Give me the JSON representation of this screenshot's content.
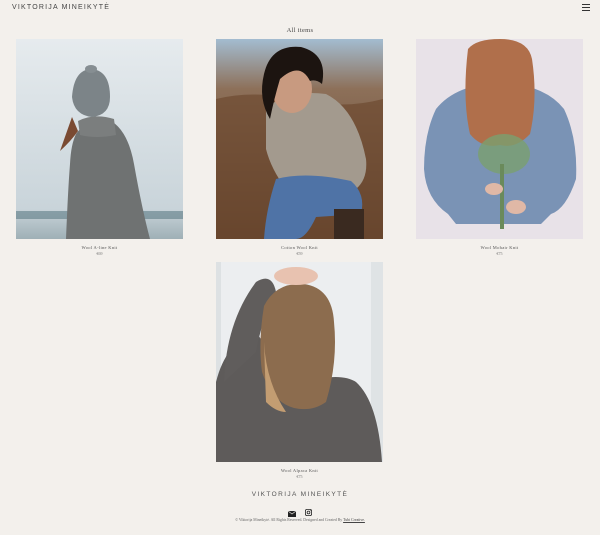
{
  "header": {
    "logo": "VIKTORIJA MINEIKYTĖ"
  },
  "main": {
    "title": "All items"
  },
  "products": [
    {
      "name": "Wool A-line Knit",
      "price": "€69"
    },
    {
      "name": "Cotton Wool Knit",
      "price": "€59"
    },
    {
      "name": "Wool Mohair Knit",
      "price": "€75"
    },
    {
      "name": "Wool Alpaca Knit",
      "price": "€75"
    }
  ],
  "footer": {
    "logo": "VIKTORIJA MINEIKYTĖ",
    "copyright": "© Viktorija Mineikytė. All Rights Reserved. Designed and Created By",
    "credit": "Tubi Creative."
  },
  "colors": {
    "background": "#f3f0ec",
    "text": "#333333"
  },
  "icons": {
    "menu": "hamburger-icon",
    "mail": "envelope-icon",
    "instagram": "instagram-icon"
  }
}
